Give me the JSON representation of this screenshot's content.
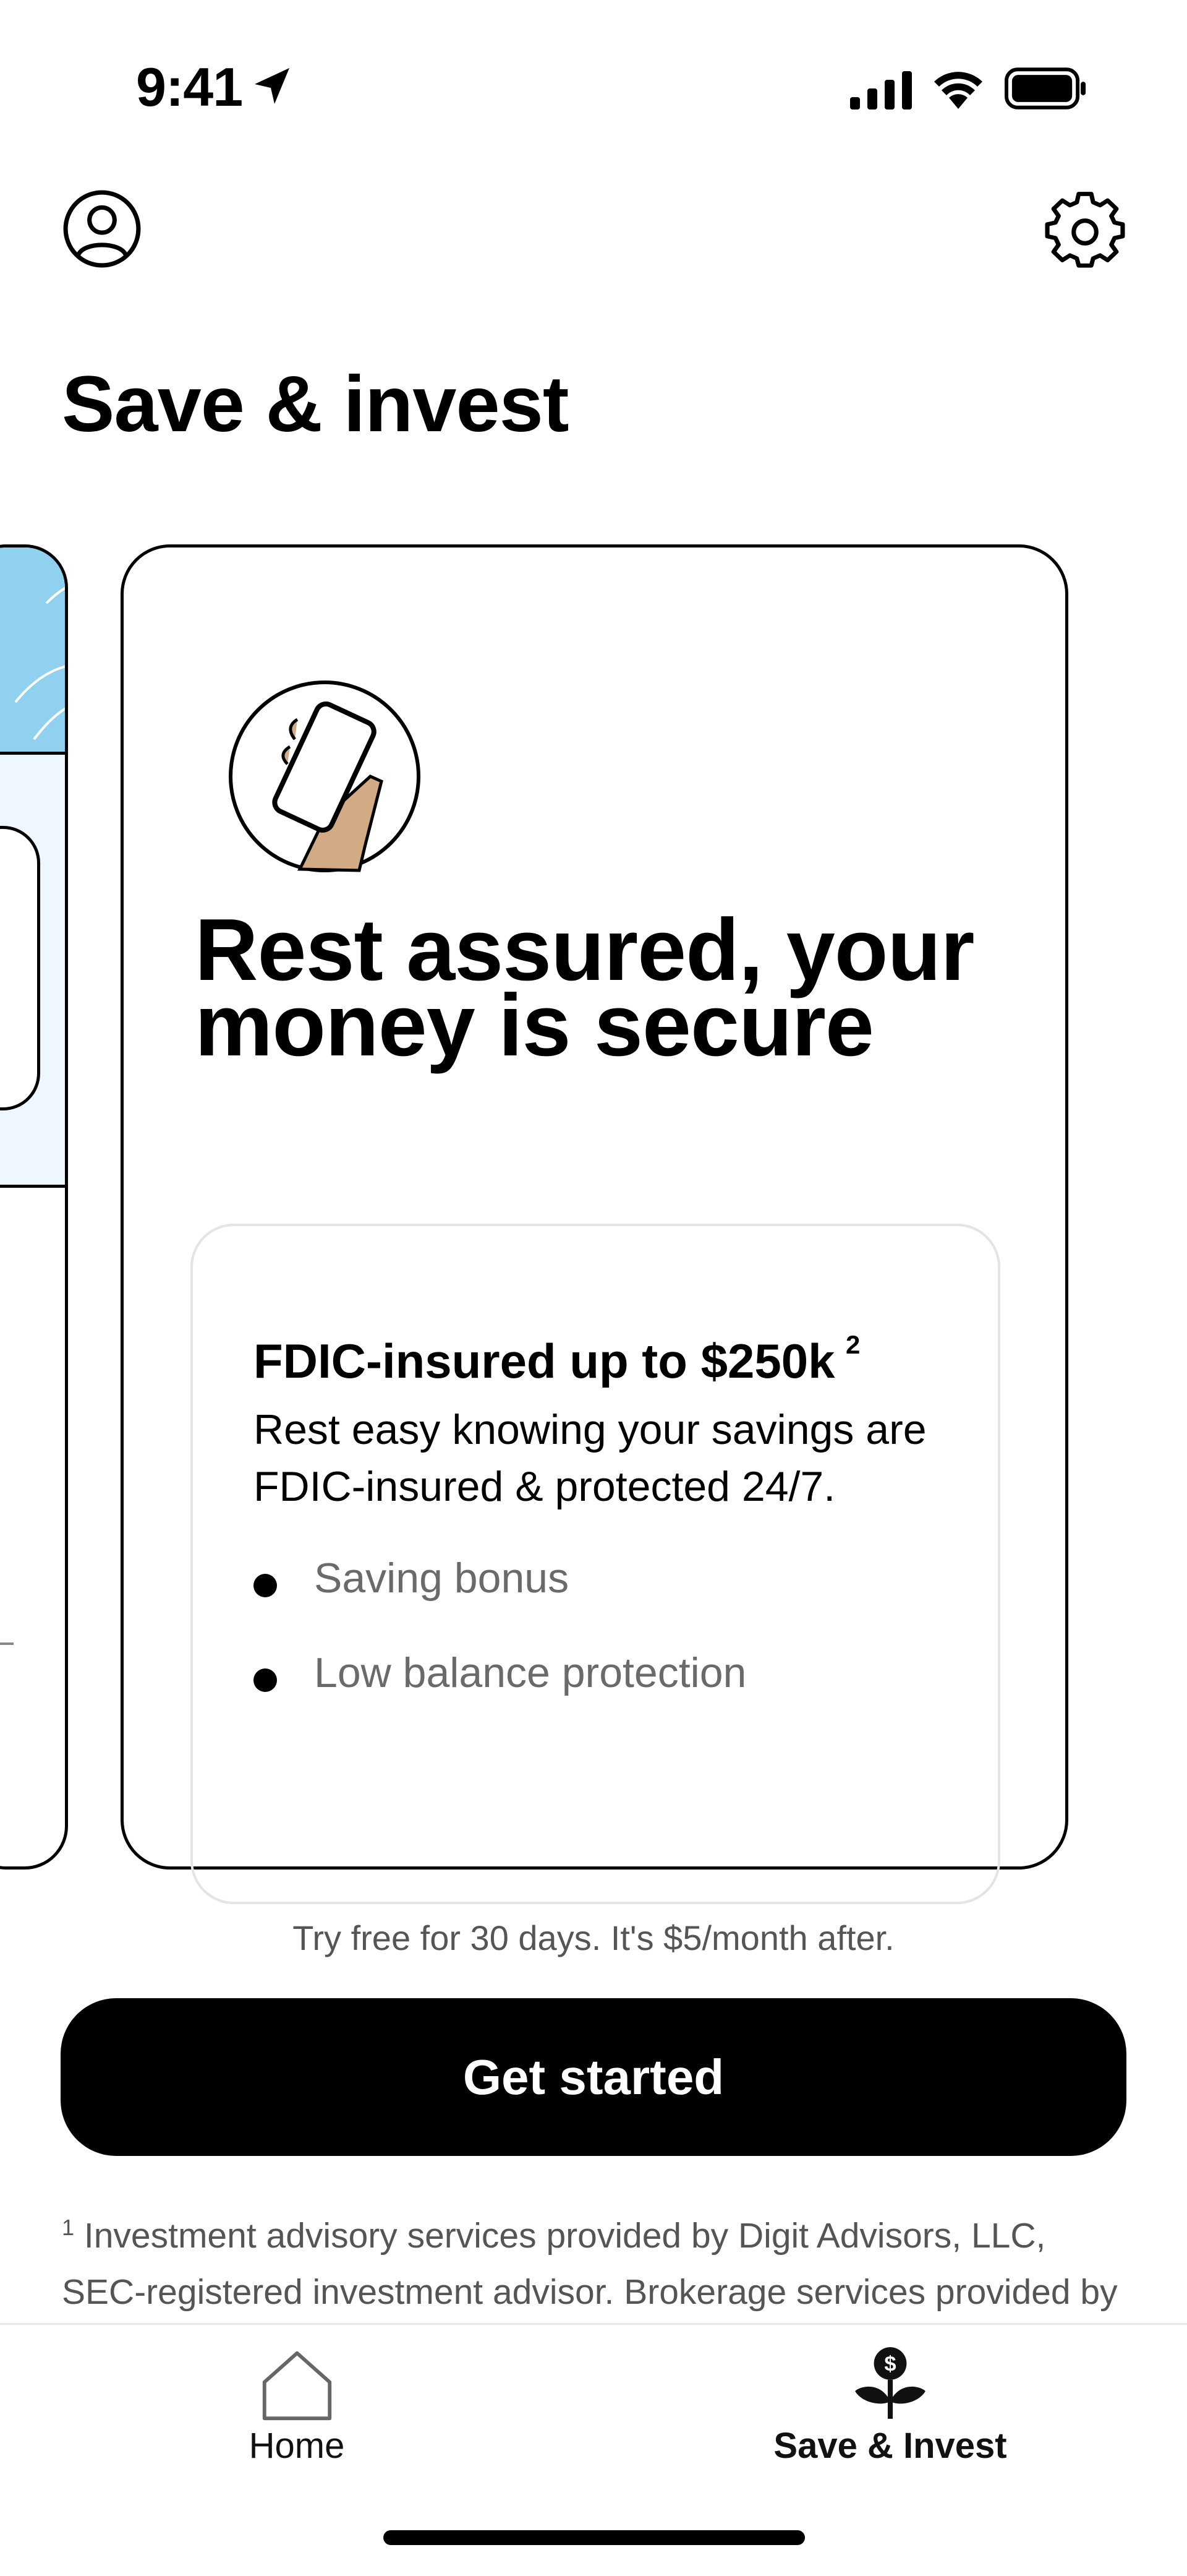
{
  "status_bar": {
    "time": "9:41"
  },
  "header": {
    "title": "Save & invest"
  },
  "card": {
    "heading": "Rest assured, your money is secure",
    "info_title": "FDIC-insured up to $250k",
    "info_sup": "2",
    "info_desc": "Rest easy knowing your savings are FDIC-insured & protected 24/7.",
    "bullets": [
      "Saving bonus",
      "Low balance protection"
    ]
  },
  "trial_text": "Try free for 30 days. It's $5/month after.",
  "cta": {
    "label": "Get started"
  },
  "footnote": {
    "marker": "1",
    "text": " Investment advisory services provided by Digit Advisors, LLC, SEC-registered investment advisor. Brokerage services provided by DriveWealth LLC, an SEC-registered broker-dealer and member of"
  },
  "tab_bar": {
    "items": [
      {
        "label": "Home",
        "active": false
      },
      {
        "label": "Save & Invest",
        "active": true
      }
    ]
  },
  "colors": {
    "primary": "#000000",
    "peek_blue": "#8fd1ee",
    "muted_text": "#555555"
  },
  "icons": [
    "location-arrow-icon",
    "signal-icon",
    "wifi-icon",
    "battery-icon",
    "profile-icon",
    "gear-icon",
    "phone-hand-illustration",
    "home-icon",
    "money-plant-icon"
  ]
}
